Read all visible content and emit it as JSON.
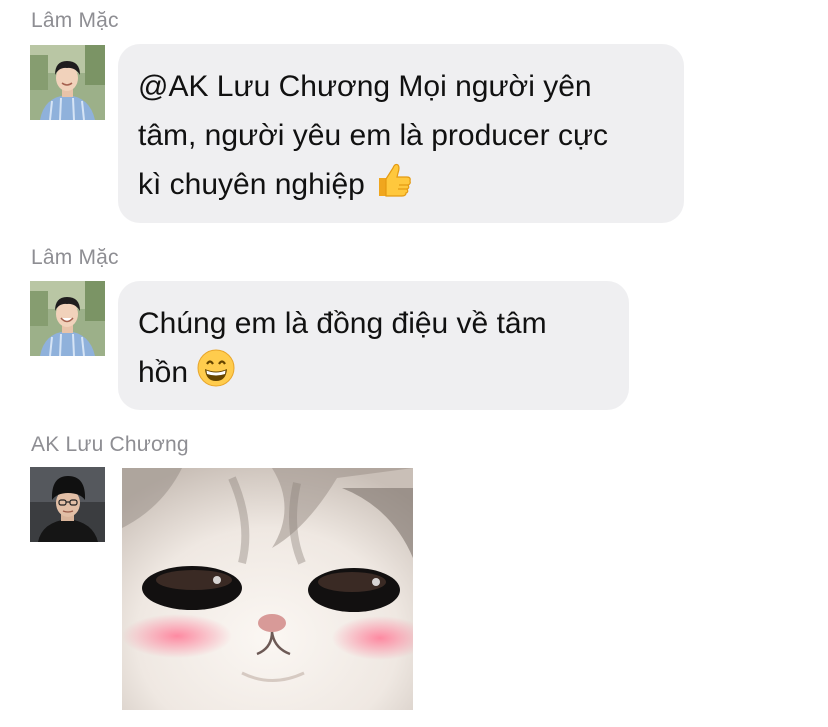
{
  "messages": [
    {
      "sender": "Lâm Mặc",
      "avatar_icon": "boy-striped-shirt-avatar",
      "lines": [
        "@AK Lưu Chương Mọi người yên",
        "tâm, người yêu em là producer cực",
        "kì chuyên nghiệp"
      ],
      "emoji": "thumbs-up-emoji"
    },
    {
      "sender": "Lâm Mặc",
      "avatar_icon": "boy-striped-shirt-avatar",
      "lines": [
        "Chúng em là đồng điệu về tâm",
        "hồn"
      ],
      "emoji": "grinning-face-emoji"
    },
    {
      "sender": "AK Lưu Chương",
      "avatar_icon": "boy-black-beanie-avatar",
      "sticker": "blushing-kitten-sticker"
    }
  ],
  "colors": {
    "bubble": "#efeff1",
    "sender_name": "#8e8e93",
    "text": "#111111"
  }
}
